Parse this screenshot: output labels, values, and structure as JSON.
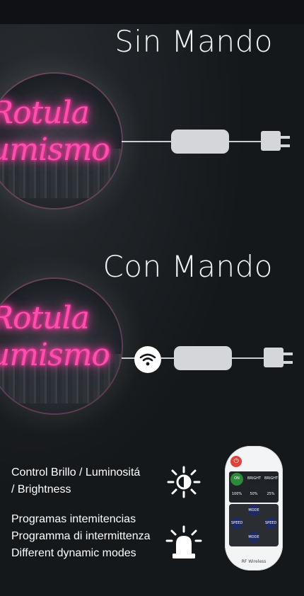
{
  "sections": {
    "without_remote_title": "Sin Mando",
    "with_remote_title": "Con Mando"
  },
  "sign": {
    "line1": "Rotula",
    "line2": "umismo",
    "neon_color": "#ff4fae"
  },
  "features": {
    "brightness_line1": "Control Brillo / Luminositá",
    "brightness_line2": "/ Brightness",
    "modes_line1": "Programas intemitencias",
    "modes_line2": "Programma di intermittenza",
    "modes_line3": "Different dynamic modes"
  },
  "remote": {
    "row1": [
      "ON",
      "BRIGHT",
      "BRIGHT"
    ],
    "row2": [
      "100%",
      "50%",
      "25%"
    ],
    "pad_top": "MODE",
    "pad_left": "SPEED",
    "pad_right": "SPEED",
    "pad_bottom": "MODE",
    "footer": "RF Wireless"
  }
}
